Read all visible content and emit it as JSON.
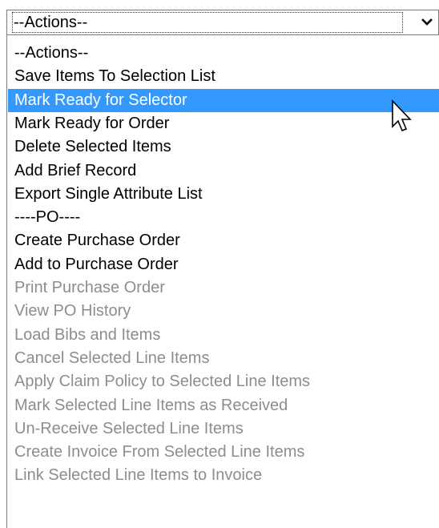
{
  "select": {
    "current_value": "--Actions--",
    "arrow_icon": "chevron-down-icon"
  },
  "dropdown": {
    "options": [
      {
        "label": "--Actions--",
        "state": "normal"
      },
      {
        "label": "Save Items To Selection List",
        "state": "normal"
      },
      {
        "label": "Mark Ready for Selector",
        "state": "highlighted"
      },
      {
        "label": "Mark Ready for Order",
        "state": "normal"
      },
      {
        "label": "Delete Selected Items",
        "state": "normal"
      },
      {
        "label": "Add Brief Record",
        "state": "normal"
      },
      {
        "label": "Export Single Attribute List",
        "state": "normal"
      },
      {
        "label": "----PO----",
        "state": "normal"
      },
      {
        "label": "Create Purchase Order",
        "state": "normal"
      },
      {
        "label": "Add to Purchase Order",
        "state": "normal"
      },
      {
        "label": "Print Purchase Order",
        "state": "disabled"
      },
      {
        "label": "View PO History",
        "state": "disabled"
      },
      {
        "label": "Load Bibs and Items",
        "state": "disabled"
      },
      {
        "label": "Cancel Selected Line Items",
        "state": "disabled"
      },
      {
        "label": "Apply Claim Policy to Selected Line Items",
        "state": "disabled"
      },
      {
        "label": "Mark Selected Line Items as Received",
        "state": "disabled"
      },
      {
        "label": "Un-Receive Selected Line Items",
        "state": "disabled"
      },
      {
        "label": "Create Invoice From Selected Line Items",
        "state": "disabled"
      },
      {
        "label": "Link Selected Line Items to Invoice",
        "state": "disabled"
      }
    ]
  },
  "colors": {
    "highlight": "#3399ff",
    "disabled_text": "#8d8d8d"
  },
  "pointer": {
    "icon": "arrow-cursor-icon"
  }
}
